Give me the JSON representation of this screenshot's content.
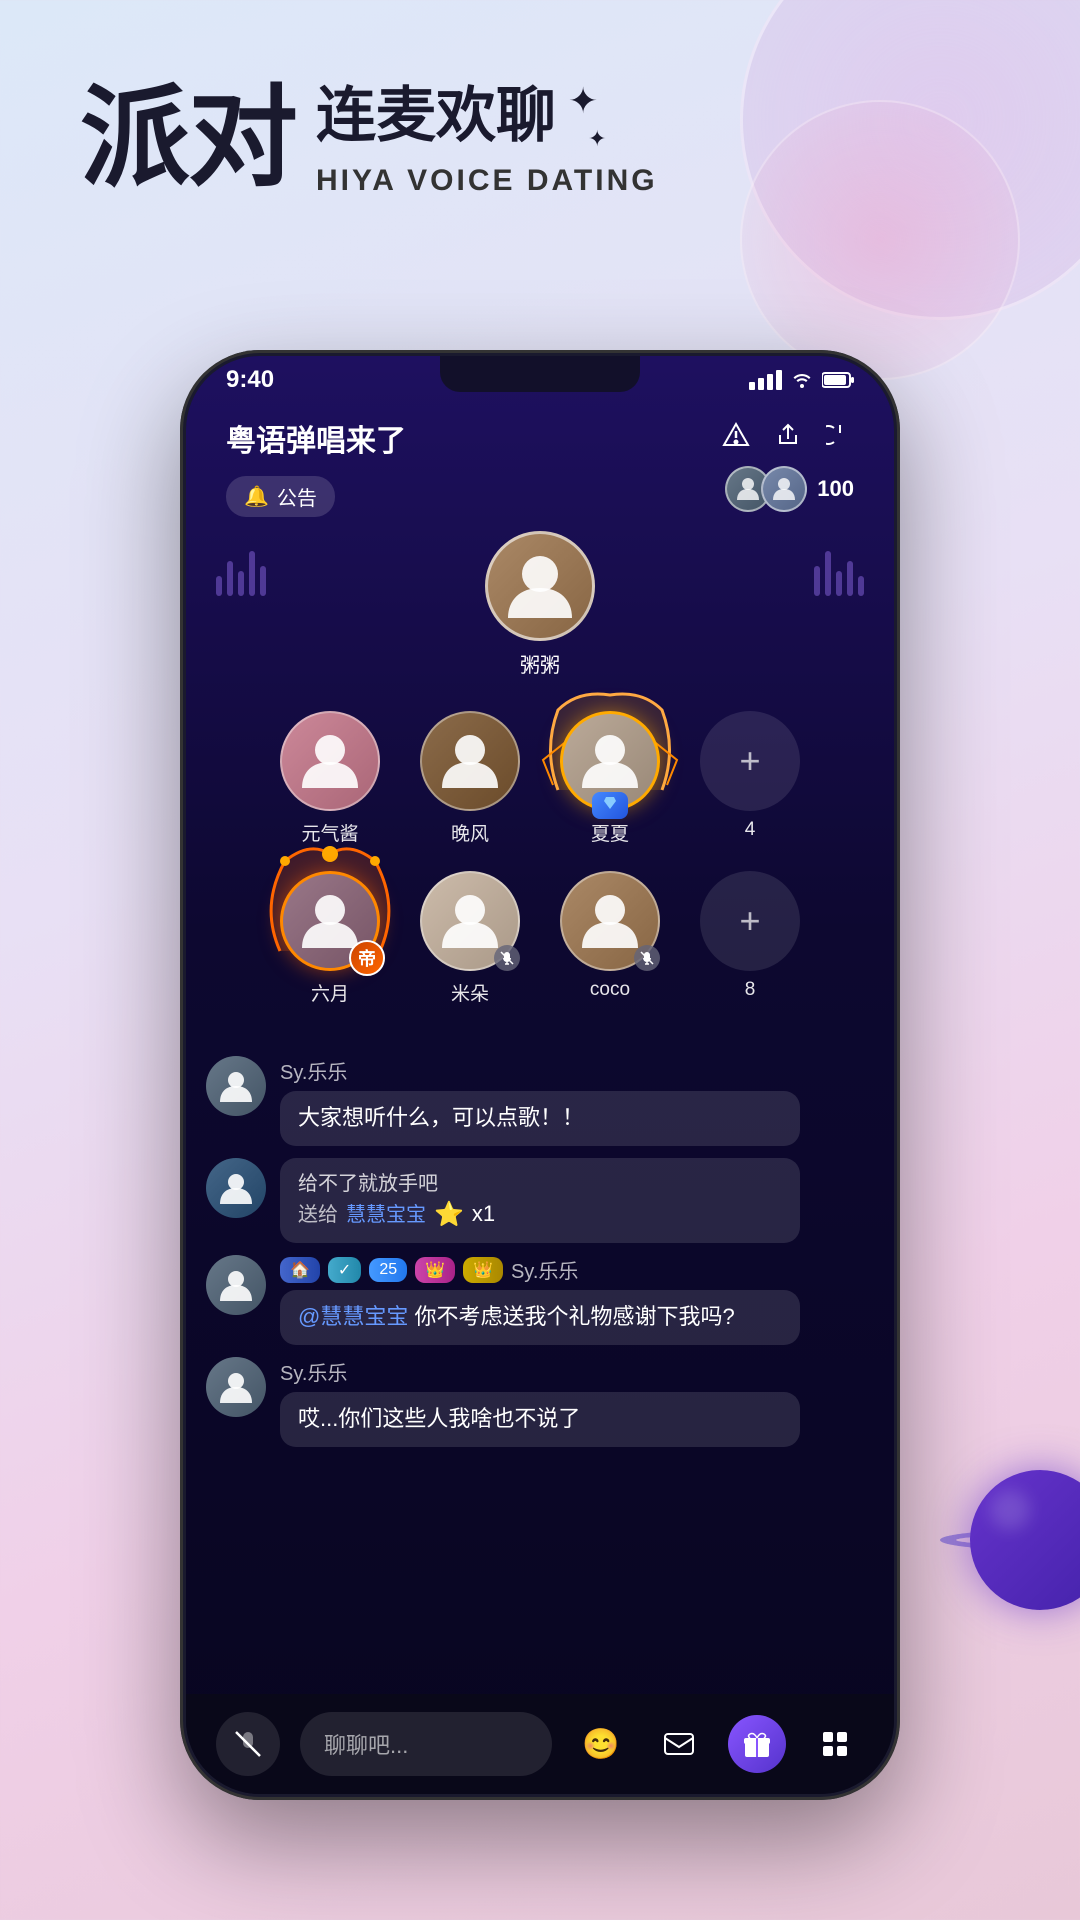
{
  "app": {
    "background": {
      "gradient_start": "#dce8f8",
      "gradient_end": "#e8c8d8"
    }
  },
  "header": {
    "title_chinese_big": "派对",
    "title_chinese_sub": "连麦欢聊",
    "title_sparkle": "✦",
    "title_english": "HIYA VOICE DATING",
    "sparkle_symbol": "✦"
  },
  "phone": {
    "status_bar": {
      "time": "9:40",
      "signal": "▐▐▐",
      "wifi": "WiFi",
      "battery": "Battery"
    },
    "room": {
      "title": "粤语弹唱来了",
      "announce_label": "公告",
      "audience_count": "100",
      "icons": [
        "triangle-alert",
        "share",
        "power"
      ]
    },
    "stage": {
      "host": {
        "name": "粥粥",
        "avatar_type": "female-1"
      },
      "seats_row1": [
        {
          "name": "元气酱",
          "avatar_type": "female-2",
          "status": "normal"
        },
        {
          "name": "晚风",
          "avatar_type": "female-3",
          "status": "normal"
        },
        {
          "name": "夏夏",
          "avatar_type": "female-4",
          "status": "diamond"
        }
      ],
      "seats_row2": [
        {
          "name": "六月",
          "avatar_type": "female-5",
          "status": "crown"
        },
        {
          "name": "米朵",
          "avatar_type": "female-6",
          "status": "muted"
        },
        {
          "name": "coco",
          "avatar_type": "female-7",
          "status": "muted"
        },
        {
          "name": "4",
          "avatar_type": "add",
          "status": "add"
        }
      ],
      "add_seat_count1": "4",
      "add_seat_count2": "8"
    },
    "chat": [
      {
        "username": "Sy.乐乐",
        "message": "大家想听什么，可以点歌！！",
        "type": "normal"
      },
      {
        "username": "",
        "message": "给不了就放手吧",
        "gift_prefix": "送给",
        "gift_recipient": "慧慧宝宝",
        "gift_icon": "⭐",
        "gift_count": "x1",
        "type": "gift"
      },
      {
        "username": "Sy.乐乐",
        "badges": [
          "🏠",
          "✓",
          "25",
          "👑",
          "👑"
        ],
        "mention": "@慧慧宝宝",
        "message": " 你不考虑送我个礼物感谢下我吗?",
        "type": "mention"
      },
      {
        "username": "Sy.乐乐",
        "message": "哎...你们这些人我啥也不说了",
        "type": "normal"
      }
    ],
    "bottom_bar": {
      "mute_label": "🔇",
      "chat_placeholder": "聊聊吧...",
      "emoji_icon": "😊",
      "mail_icon": "✉",
      "gift_icon": "🎁",
      "grid_icon": "⊞"
    }
  }
}
